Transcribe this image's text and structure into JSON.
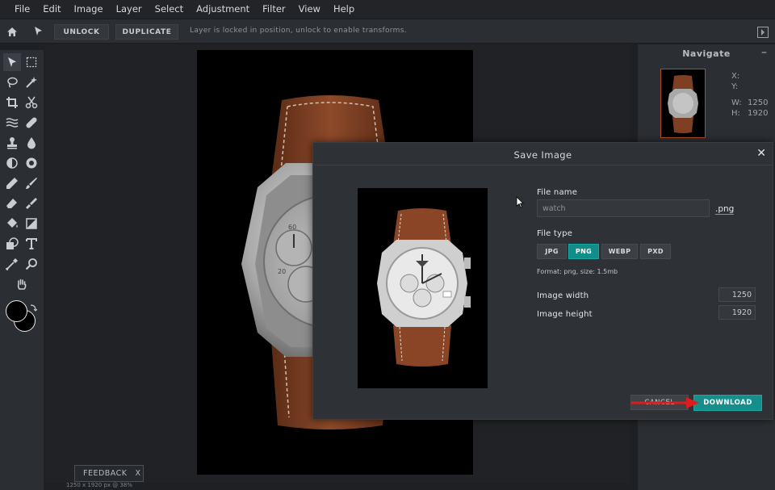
{
  "menubar": {
    "items": [
      "File",
      "Edit",
      "Image",
      "Layer",
      "Select",
      "Adjustment",
      "Filter",
      "View",
      "Help"
    ]
  },
  "toolbar": {
    "unlock_label": "UNLOCK",
    "duplicate_label": "DUPLICATE",
    "lock_message": "Layer is locked in position, unlock to enable transforms."
  },
  "navigator": {
    "title": "Navigate",
    "collapse": "–",
    "x_label": "X:",
    "y_label": "Y:",
    "w_label": "W:",
    "w_value": "1250",
    "h_label": "H:",
    "h_value": "1920"
  },
  "status": {
    "text": "1250 x 1920 px @ 38%",
    "feedback_label": "FEEDBACK",
    "feedback_close": "X"
  },
  "modal": {
    "title": "Save Image",
    "close": "✕",
    "file_name_label": "File name",
    "file_name_value": "watch",
    "extension": ".png",
    "file_type_label": "File type",
    "file_types": [
      "JPG",
      "PNG",
      "WEBP",
      "PXD"
    ],
    "selected_type": "PNG",
    "format_info": "Format: png, size: 1.5mb",
    "width_label": "Image width",
    "width_value": "1250",
    "height_label": "Image height",
    "height_value": "1920",
    "cancel_label": "CANCEL",
    "download_label": "DOWNLOAD"
  },
  "colors": {
    "accent": "#148f8b",
    "foreground_swatch": "#000000",
    "background_swatch": "#000000",
    "annotation_arrow": "#e01b1b",
    "strap": "#8a4527"
  },
  "icons": {
    "toolbar": [
      "home-icon",
      "move-pointer-icon",
      "panel-toggle-icon"
    ],
    "tools": [
      "select-arrow-icon",
      "marquee-icon",
      "lasso-icon",
      "magic-wand-icon",
      "crop-icon",
      "scissors-icon",
      "liquify-icon",
      "bandage-icon",
      "stamp-icon",
      "drop-icon",
      "dodge-icon",
      "sponge-icon",
      "pencil-icon",
      "brush-icon",
      "eraser-icon",
      "smudge-icon",
      "bucket-icon",
      "gradient-icon",
      "shape-icon",
      "text-icon",
      "eyedropper-icon",
      "zoom-icon",
      "hand-icon"
    ]
  }
}
